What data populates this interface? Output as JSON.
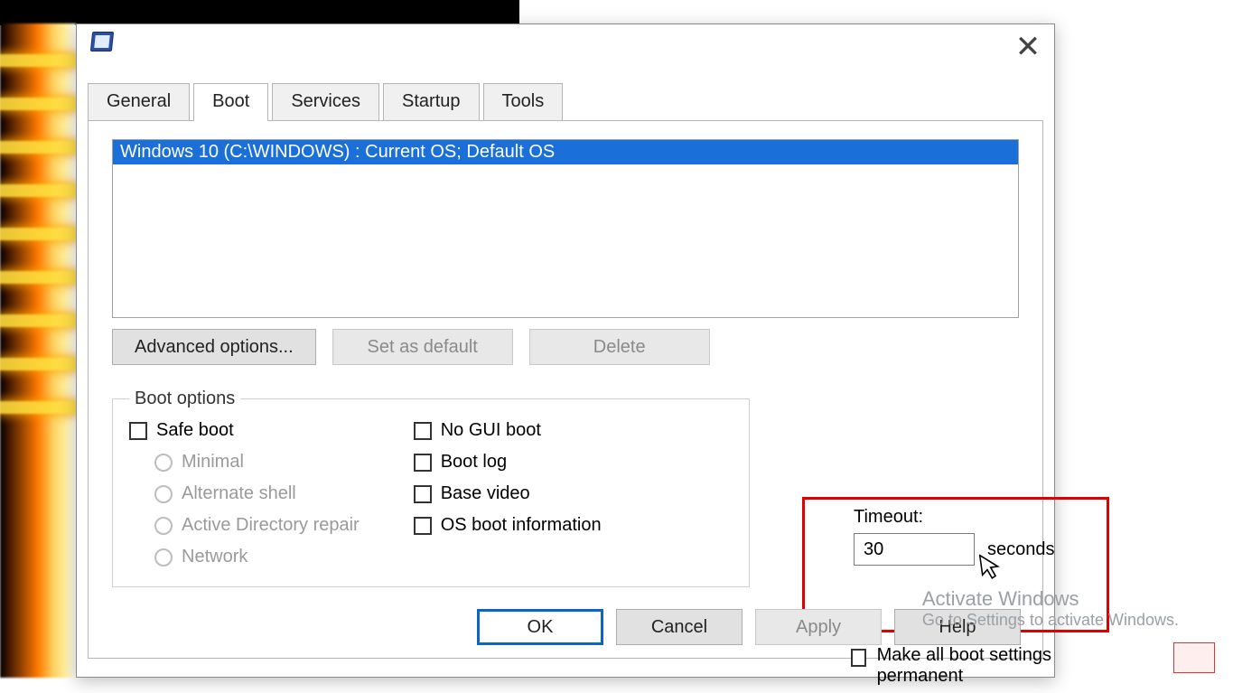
{
  "tabs": {
    "general": "General",
    "boot": "Boot",
    "services": "Services",
    "startup": "Startup",
    "tools": "Tools"
  },
  "oslist": {
    "row0": "Windows 10 (C:\\WINDOWS) : Current OS; Default OS"
  },
  "buttons": {
    "advanced": "Advanced options...",
    "setdefault": "Set as default",
    "delete": "Delete",
    "ok": "OK",
    "cancel": "Cancel",
    "apply": "Apply",
    "help": "Help"
  },
  "boot_options": {
    "legend": "Boot options",
    "safe_boot": "Safe boot",
    "minimal": "Minimal",
    "alt_shell": "Alternate shell",
    "ad_repair": "Active Directory repair",
    "network": "Network",
    "no_gui": "No GUI boot",
    "boot_log": "Boot log",
    "base_video": "Base video",
    "os_boot_info": "OS boot information"
  },
  "timeout": {
    "label": "Timeout:",
    "value": "30",
    "unit": "seconds"
  },
  "permanent": "Make all boot settings permanent",
  "watermark": {
    "line1": "Activate Windows",
    "line2": "Go to Settings to activate Windows."
  }
}
